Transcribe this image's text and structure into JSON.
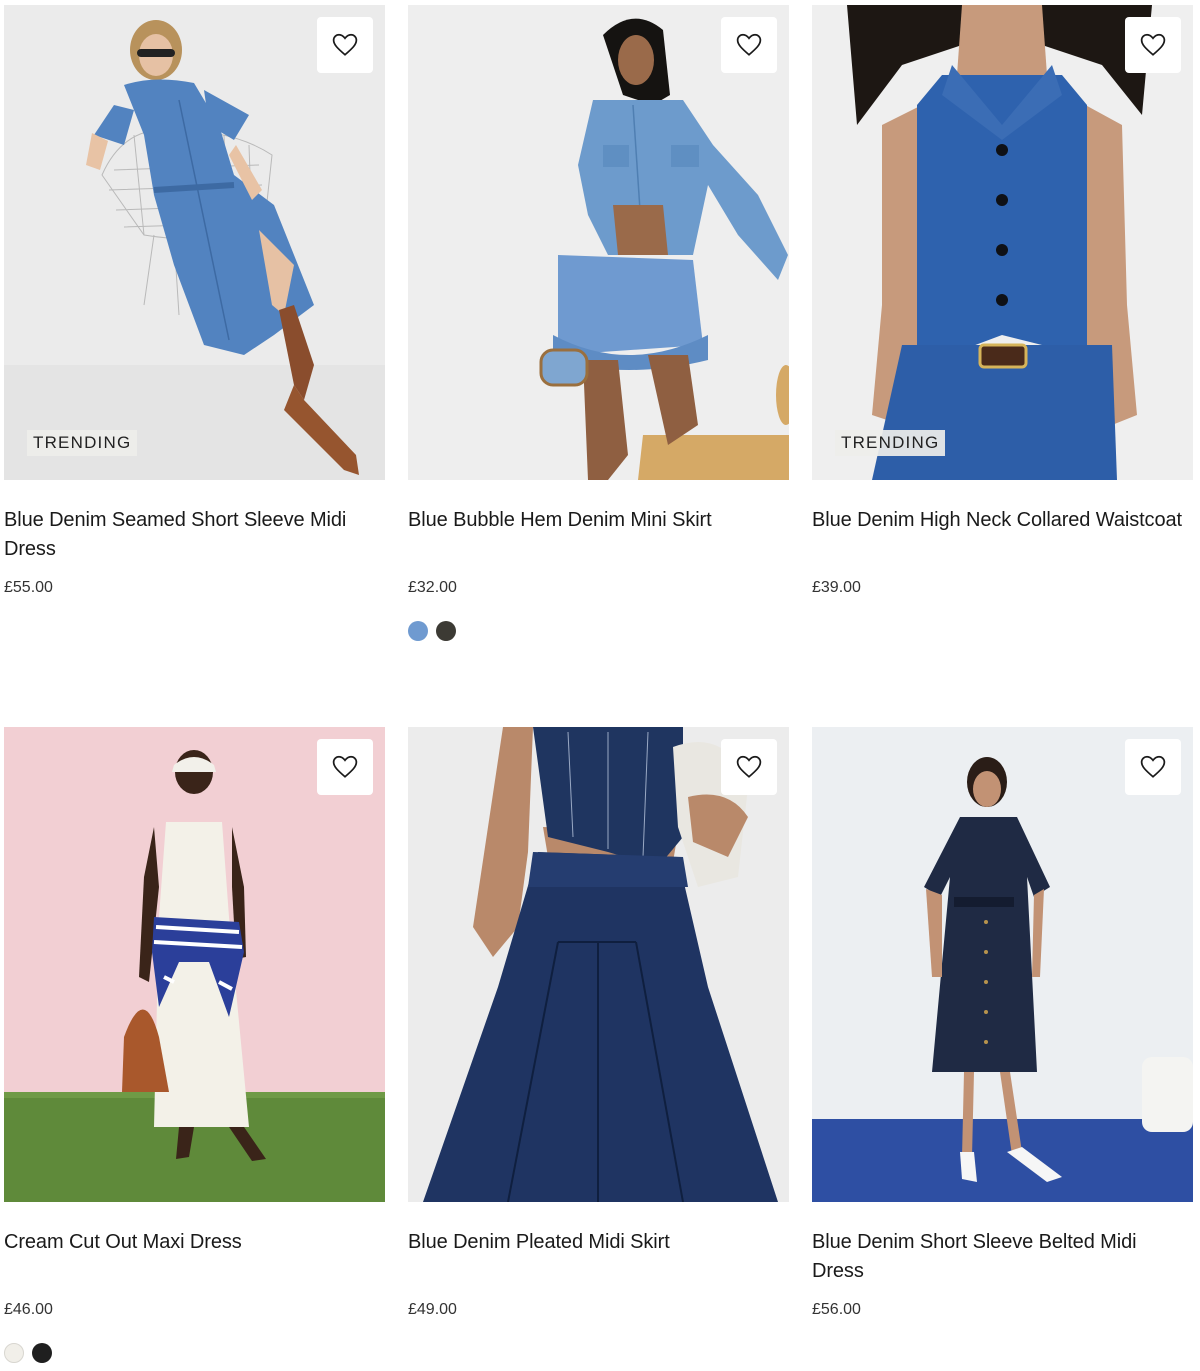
{
  "products": [
    {
      "name": "Blue Denim Seamed Short Sleeve Midi Dress",
      "price": "£55.00",
      "badge": "TRENDING",
      "image_background": "#ececec",
      "swatches": []
    },
    {
      "name": "Blue Bubble Hem Denim Mini Skirt",
      "price": "£32.00",
      "badge": "",
      "image_background": "#efefef",
      "swatches": [
        {
          "color": "#6f9ad0"
        },
        {
          "color": "#3c3a34"
        }
      ]
    },
    {
      "name": "Blue Denim High Neck Collared Waistcoat",
      "price": "£39.00",
      "badge": "TRENDING",
      "image_background": "#eeeeee",
      "swatches": []
    },
    {
      "name": "Cream Cut Out Maxi Dress",
      "price": "£46.00",
      "badge": "",
      "image_background": "#f2cfd3",
      "swatches": [
        {
          "color": "#f1efe9"
        },
        {
          "color": "#1f1f1f"
        }
      ]
    },
    {
      "name": "Blue Denim Pleated Midi Skirt",
      "price": "£49.00",
      "badge": "",
      "image_background": "#ececec",
      "swatches": []
    },
    {
      "name": "Blue Denim Short Sleeve Belted Midi Dress",
      "price": "£56.00",
      "badge": "",
      "image_background": "#eceff2",
      "swatches": []
    }
  ],
  "icons": {
    "wishlist": "heart-outline-icon"
  }
}
